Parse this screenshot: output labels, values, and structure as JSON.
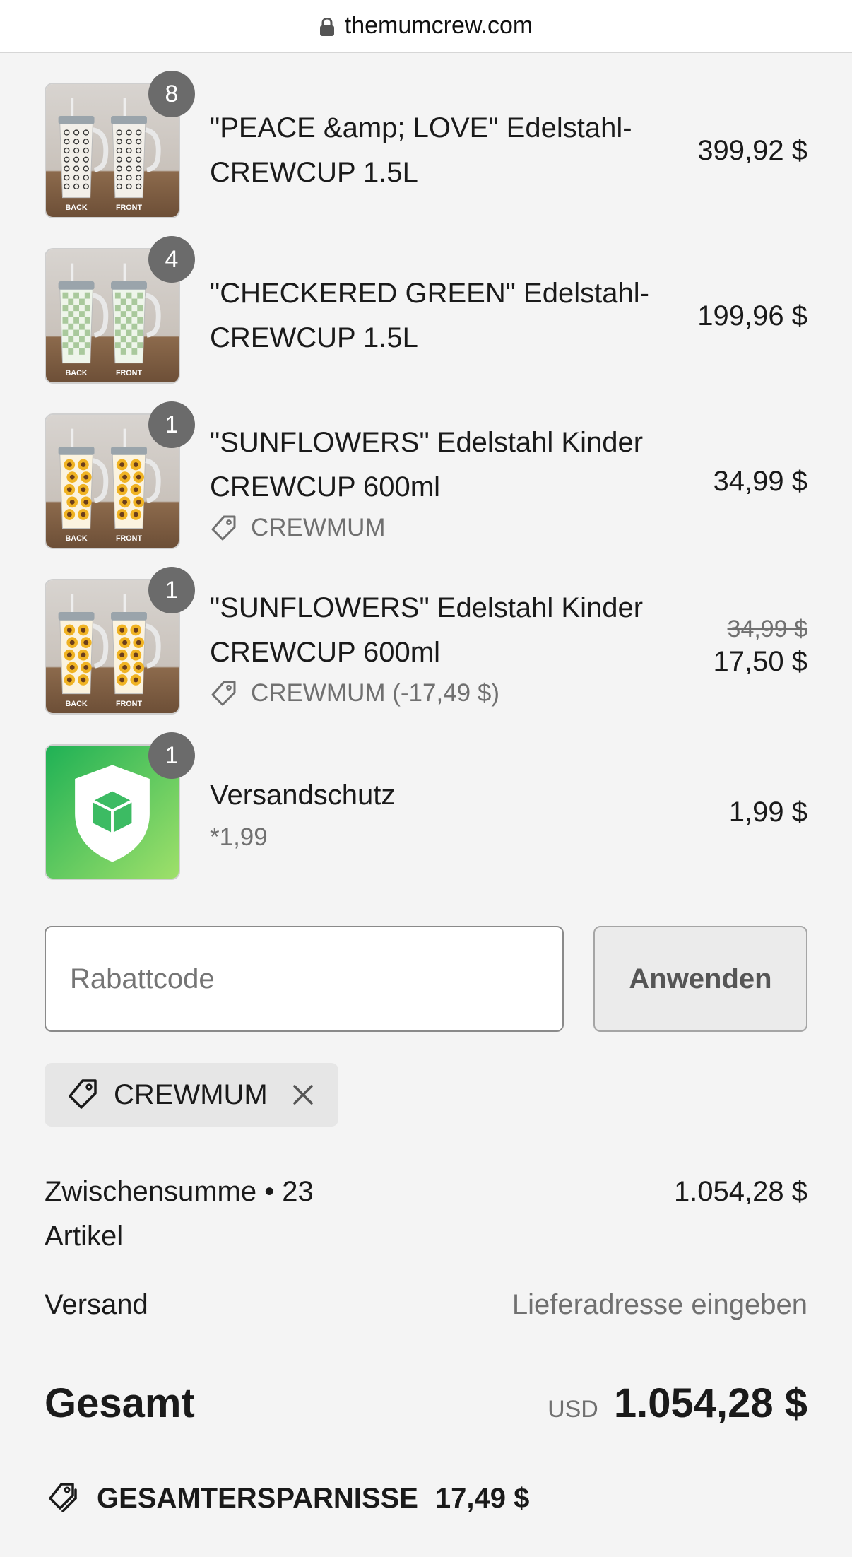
{
  "browser": {
    "url": "themumcrew.com"
  },
  "items": [
    {
      "qty": "8",
      "title": "\"PEACE &amp; LOVE\" Edelstahl-CREWCUP 1.5L",
      "discount": "",
      "subtitle": "",
      "old_price": "",
      "price": "399,92 $",
      "pattern": "peace",
      "labels": [
        "BACK",
        "FRONT"
      ]
    },
    {
      "qty": "4",
      "title": "\"CHECKERED GREEN\" Edelstahl-CREWCUP 1.5L",
      "discount": "",
      "subtitle": "",
      "old_price": "",
      "price": "199,96 $",
      "pattern": "checkered",
      "labels": [
        "BACK",
        "FRONT"
      ]
    },
    {
      "qty": "1",
      "title": "\"SUNFLOWERS\" Edelstahl Kinder CREWCUP 600ml",
      "discount": "CREWMUM",
      "subtitle": "",
      "old_price": "",
      "price": "34,99 $",
      "pattern": "sunflower",
      "labels": [
        "BACK",
        "FRONT"
      ]
    },
    {
      "qty": "1",
      "title": "\"SUNFLOWERS\" Edelstahl Kinder CREWCUP 600ml",
      "discount": "CREWMUM (-17,49 $)",
      "subtitle": "",
      "old_price": "34,99 $",
      "price": "17,50 $",
      "pattern": "sunflower",
      "labels": [
        "BACK",
        "FRONT"
      ]
    },
    {
      "qty": "1",
      "title": "Versandschutz",
      "discount": "",
      "subtitle": "*1,99",
      "old_price": "",
      "price": "1,99 $",
      "pattern": "shield",
      "labels": []
    }
  ],
  "discount_form": {
    "placeholder": "Rabattcode",
    "apply_label": "Anwenden"
  },
  "applied_code": {
    "code": "CREWMUM"
  },
  "summary": {
    "subtotal_label": "Zwischensumme • 23",
    "subtotal_label_2": "Artikel",
    "subtotal_value": "1.054,28 $",
    "shipping_label": "Versand",
    "shipping_value": "Lieferadresse eingeben",
    "total_label": "Gesamt",
    "total_currency": "USD",
    "total_value": "1.054,28 $",
    "savings_label": "GESAMTERSPARNISSE",
    "savings_value": "17,49 $"
  },
  "colors": {
    "background": "#f4f4f4",
    "badge": "#6b6b6b",
    "shield_green": "#2fb85a"
  },
  "icons": [
    "lock-icon",
    "tag-icon",
    "close-icon",
    "shield-icon"
  ]
}
